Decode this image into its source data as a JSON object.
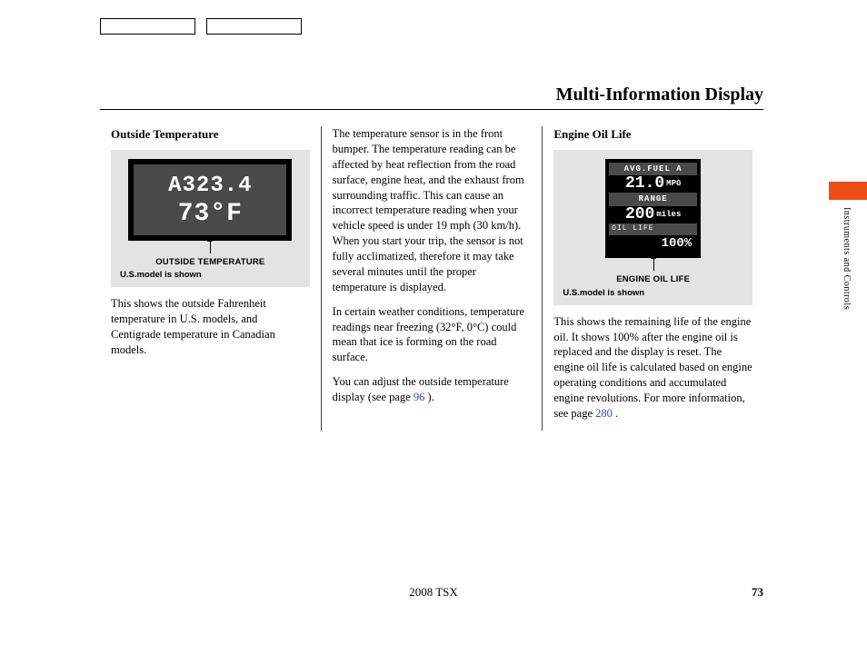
{
  "header": {
    "title": "Multi-Information Display"
  },
  "columns": {
    "left": {
      "heading": "Outside Temperature",
      "display": {
        "line1": "A323.4",
        "line2": "73°F"
      },
      "caption_main": "OUTSIDE TEMPERATURE",
      "caption_sub": "U.S.model is shown",
      "body": "This shows the outside Fahrenheit temperature in U.S. models, and Centigrade temperature in Canadian models."
    },
    "middle": {
      "para1": "The temperature sensor is in the front bumper. The temperature reading can be affected by heat reflection from the road surface, engine heat, and the exhaust from surrounding traffic. This can cause an incorrect temperature reading when your vehicle speed is under 19 mph (30 km/h). When you start your trip, the sensor is not fully acclimatized, therefore it may take several minutes until the proper temperature is displayed.",
      "para2": "In certain weather conditions, temperature readings near freezing (32°F, 0°C) could mean that ice is forming on the road surface.",
      "para3_pre": "You can adjust the outside temperature display (see page ",
      "para3_link": "96",
      "para3_post": " )."
    },
    "right": {
      "heading": "Engine Oil Life",
      "display": {
        "avg_label": "AVG.FUEL  A",
        "avg_value": "21.0",
        "avg_unit": "MPG",
        "range_label": "RANGE",
        "range_value": "200",
        "range_unit": "miles",
        "oil_label": "OIL LIFE",
        "oil_value": "100%"
      },
      "caption_main": "ENGINE OIL LIFE",
      "caption_sub": "U.S.model is shown",
      "body_pre": "This shows the remaining life of the engine oil. It shows 100% after the engine oil is replaced and the display is reset. The engine oil life is calculated based on engine operating conditions and accumulated engine revolutions. For more information, see page ",
      "body_link": "280",
      "body_post": " ."
    }
  },
  "side_tab": "Instruments and Controls",
  "footer": {
    "model": "2008  TSX",
    "page": "73"
  }
}
